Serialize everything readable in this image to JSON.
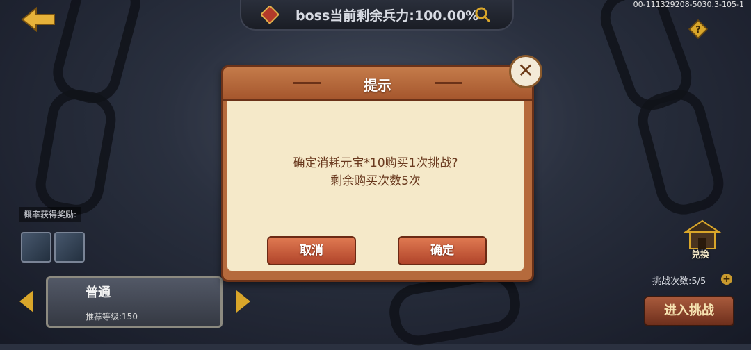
{
  "top_bar": {
    "boss_status": "boss当前剩余兵力:100.00%",
    "build_id": "00-111329208-5030.3-105-1"
  },
  "left_panel": {
    "probability_label": "概率获得奖励:",
    "difficulty": "普通",
    "recommended_level": "推荐等级:150"
  },
  "right_panel": {
    "exchange_label": "兑换",
    "challenge_count": "挑战次数:5/5",
    "enter_label": "进入挑战"
  },
  "dialog": {
    "title": "提示",
    "message_line1": "确定消耗元宝*10购买1次挑战?",
    "message_line2": "剩余购买次数5次",
    "cancel_label": "取消",
    "confirm_label": "确定",
    "close_glyph": "✕"
  },
  "colors": {
    "dialog_frame": "#b56a3c",
    "dialog_body": "#f5e9c9",
    "button": "#c85a3a",
    "accent_gold": "#d9a62a"
  }
}
